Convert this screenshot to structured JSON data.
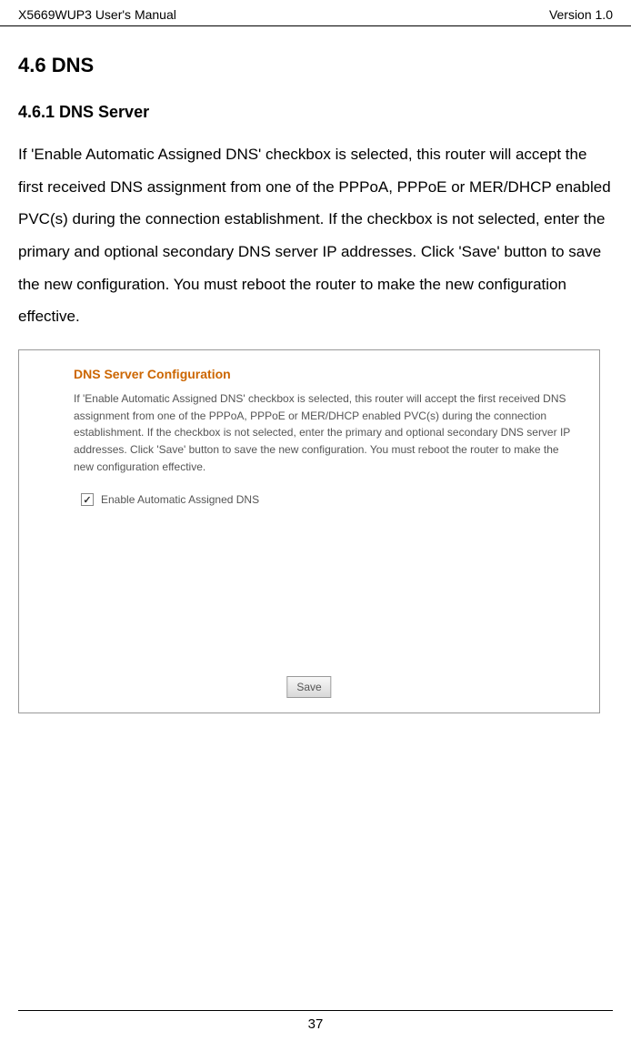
{
  "header": {
    "left": "X5669WUP3 User's Manual",
    "right": "Version 1.0"
  },
  "section": {
    "title": "4.6 DNS",
    "subsection_title": "4.6.1 DNS Server",
    "body": "If 'Enable Automatic Assigned DNS' checkbox is selected, this router will accept the first received DNS assignment from one of the PPPoA, PPPoE or MER/DHCP enabled PVC(s) during the connection establishment. If the checkbox is not selected, enter the primary and optional secondary DNS server IP addresses. Click 'Save' button to save the new configuration. You must reboot the router to make the new configuration effective."
  },
  "screenshot": {
    "title": "DNS Server Configuration",
    "description": "If 'Enable Automatic Assigned DNS' checkbox is selected, this router will accept the first received DNS assignment from one of the PPPoA, PPPoE or MER/DHCP enabled PVC(s) during the connection establishment. If the checkbox is not selected, enter the primary and optional secondary DNS server IP addresses. Click 'Save' button to save the new configuration. You must reboot the router to make the new configuration effective.",
    "checkbox_checked": true,
    "checkbox_label": "Enable Automatic Assigned DNS",
    "save_label": "Save"
  },
  "footer": {
    "page_number": "37"
  }
}
